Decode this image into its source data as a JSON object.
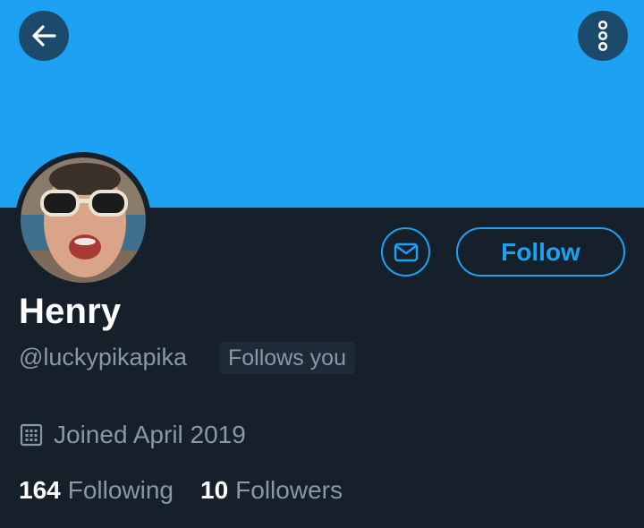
{
  "profile": {
    "name": "Henry",
    "handle": "@luckypikapika",
    "follows_you": "Follows you",
    "joined": "Joined April 2019",
    "following_count": "164",
    "following_label": "Following",
    "followers_count": "10",
    "followers_label": "Followers"
  },
  "actions": {
    "follow_label": "Follow"
  },
  "icons": {
    "back": "arrow-left-icon",
    "more": "vertical-dots-icon",
    "message": "envelope-icon",
    "calendar": "calendar-icon"
  },
  "colors": {
    "banner": "#1da1f2",
    "accent": "#1da1f2",
    "background": "#15202b",
    "muted_text": "#8899a6"
  }
}
